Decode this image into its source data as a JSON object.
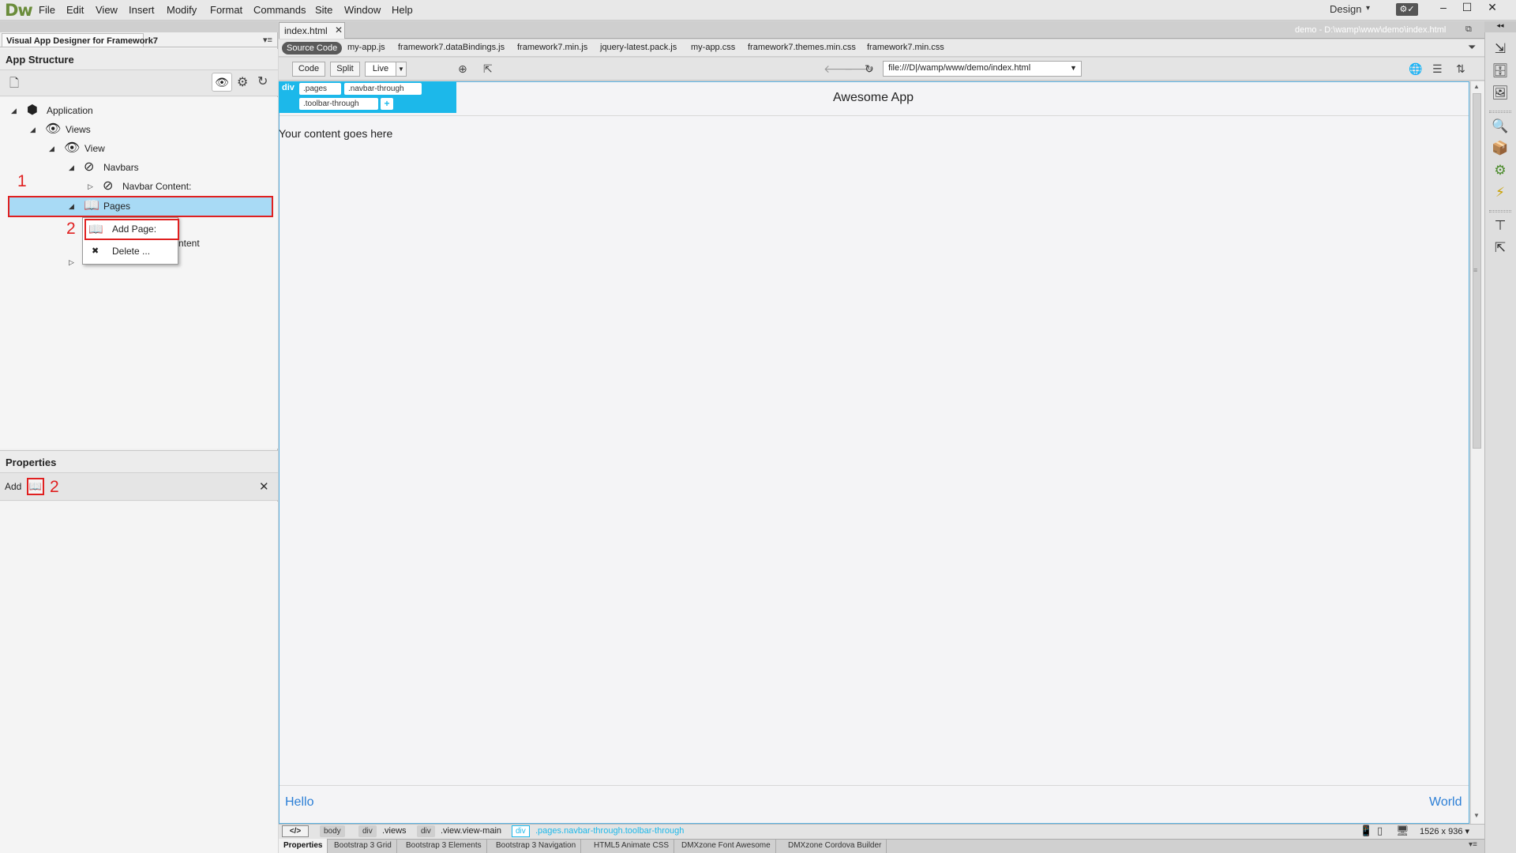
{
  "app": {
    "logo": "Dw"
  },
  "menu": [
    "File",
    "Edit",
    "View",
    "Insert",
    "Modify",
    "Format",
    "Commands",
    "Site",
    "Window",
    "Help"
  ],
  "workspace": {
    "label": "Design"
  },
  "window_controls": {
    "minimize": "–",
    "maximize": "☐",
    "close": "✕"
  },
  "left_panel": {
    "tab_title": "Visual App Designer for Framework7",
    "structure_title": "App Structure",
    "tree": [
      {
        "label": "Application",
        "icon": "cube-icon"
      },
      {
        "label": "Views",
        "icon": "eye-icon"
      },
      {
        "label": "View",
        "icon": "eye-icon"
      },
      {
        "label": "Navbars",
        "icon": "compass-icon"
      },
      {
        "label": "Navbar Content:",
        "icon": "compass-icon"
      },
      {
        "label": "Pages",
        "icon": "book-icon"
      },
      {
        "label": "ntent",
        "icon": ""
      }
    ],
    "annotations": {
      "one": "1",
      "two": "2",
      "three": "2"
    },
    "context_menu": {
      "add": "Add Page:",
      "delete": "Delete ..."
    },
    "properties_title": "Properties",
    "properties_add": "Add"
  },
  "document": {
    "tab": "index.html",
    "path": "demo - D:\\wamp\\www\\demo\\index.html",
    "source_code": "Source Code",
    "related_files": [
      "my-app.js",
      "framework7.dataBindings.js",
      "framework7.min.js",
      "jquery-latest.pack.js",
      "my-app.css",
      "framework7.themes.min.css",
      "framework7.min.css"
    ],
    "views": {
      "code": "Code",
      "split": "Split",
      "live": "Live"
    },
    "url": "file:///D|/wamp/www/demo/index.html"
  },
  "design": {
    "badge": {
      "tag": "div",
      "classes": [
        ".pages",
        ".navbar-through",
        ".toolbar-through"
      ],
      "add": "+"
    },
    "title": "Awesome App",
    "content": "Your content goes here",
    "hello": "Hello",
    "world": "World"
  },
  "tag_selector": {
    "code_btn": "</>",
    "crumbs": [
      {
        "tag": "body",
        "text": ""
      },
      {
        "tag": "div",
        "text": ".views"
      },
      {
        "tag": "div",
        "text": ".view.view-main"
      }
    ],
    "selected": {
      "tag": "div",
      "text": ".pages.navbar-through.toolbar-through"
    },
    "viewport": "1526 x 936 ▾"
  },
  "bottom_tabs": [
    "Properties",
    "Bootstrap 3 Grid",
    "Bootstrap 3 Elements",
    "Bootstrap 3 Navigation",
    "HTML5 Animate CSS",
    "DMXzone Font Awesome",
    "DMXzone Cordova Builder"
  ]
}
